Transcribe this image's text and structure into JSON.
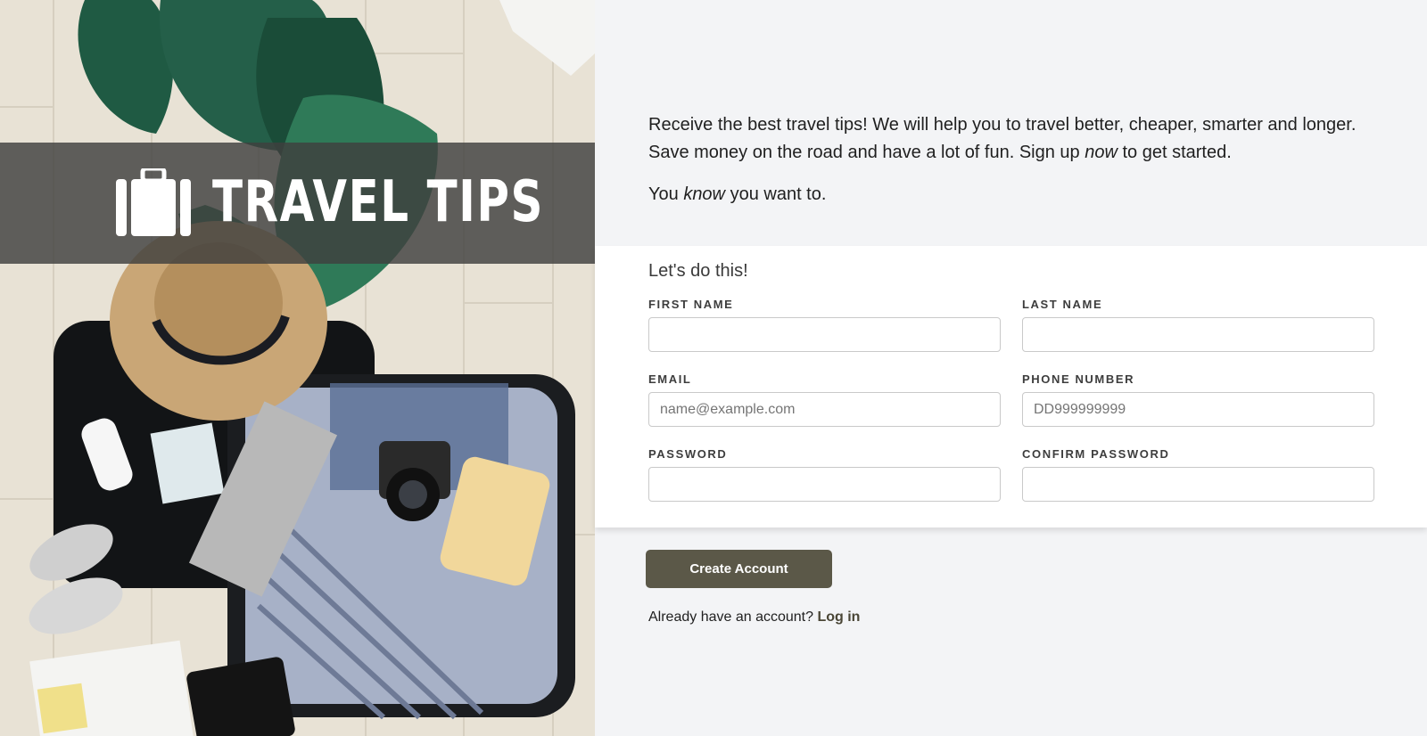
{
  "brand": {
    "name": "TRAVEL TIPS",
    "icon": "suitcase-icon"
  },
  "intro": {
    "line1_before": "Receive the best travel tips! We will help you to travel better, cheaper, smarter and longer. Save money on the road and have a lot of fun. Sign up ",
    "line1_em": "now",
    "line1_after": " to get started.",
    "line2_before": "You ",
    "line2_em": "know",
    "line2_after": " you want to."
  },
  "form": {
    "title": "Let's do this!",
    "first_name": {
      "label": "FIRST NAME",
      "value": "",
      "placeholder": ""
    },
    "last_name": {
      "label": "LAST NAME",
      "value": "",
      "placeholder": ""
    },
    "email": {
      "label": "EMAIL",
      "value": "",
      "placeholder": "name@example.com"
    },
    "phone": {
      "label": "PHONE NUMBER",
      "value": "",
      "placeholder": "DD999999999"
    },
    "password": {
      "label": "PASSWORD",
      "value": "",
      "placeholder": ""
    },
    "confirm_password": {
      "label": "CONFIRM PASSWORD",
      "value": "",
      "placeholder": ""
    }
  },
  "actions": {
    "create_label": "Create Account",
    "login_prompt": "Already have an account?",
    "login_link": "Log in"
  },
  "colors": {
    "page_bg": "#f3f4f6",
    "card_bg": "#ffffff",
    "accent": "#5b5848",
    "banner_overlay": "#40403e"
  }
}
